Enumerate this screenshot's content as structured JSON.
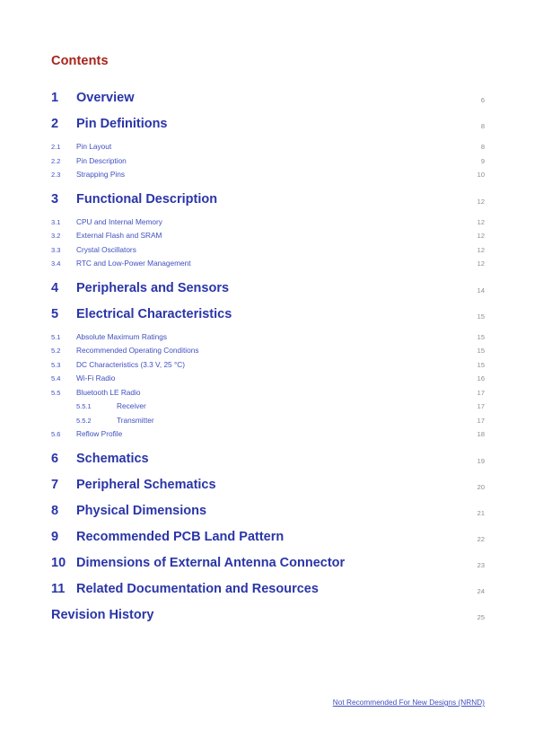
{
  "heading": "Contents",
  "toc": {
    "entries": [
      {
        "level": 1,
        "number": "1",
        "label": "Overview",
        "page": "6"
      },
      {
        "level": 1,
        "number": "2",
        "label": "Pin Definitions",
        "page": "8"
      },
      {
        "level": 2,
        "number": "2.1",
        "label": "Pin Layout",
        "page": "8"
      },
      {
        "level": 2,
        "number": "2.2",
        "label": "Pin Description",
        "page": "9"
      },
      {
        "level": 2,
        "number": "2.3",
        "label": "Strapping Pins",
        "page": "10"
      },
      {
        "level": 1,
        "number": "3",
        "label": "Functional Description",
        "page": "12"
      },
      {
        "level": 2,
        "number": "3.1",
        "label": "CPU and Internal Memory",
        "page": "12"
      },
      {
        "level": 2,
        "number": "3.2",
        "label": "External Flash and SRAM",
        "page": "12"
      },
      {
        "level": 2,
        "number": "3.3",
        "label": "Crystal Oscillators",
        "page": "12"
      },
      {
        "level": 2,
        "number": "3.4",
        "label": "RTC and Low-Power Management",
        "page": "12"
      },
      {
        "level": 1,
        "number": "4",
        "label": "Peripherals and Sensors",
        "page": "14"
      },
      {
        "level": 1,
        "number": "5",
        "label": "Electrical Characteristics",
        "page": "15"
      },
      {
        "level": 2,
        "number": "5.1",
        "label": "Absolute Maximum Ratings",
        "page": "15"
      },
      {
        "level": 2,
        "number": "5.2",
        "label": "Recommended Operating Conditions",
        "page": "15"
      },
      {
        "level": 2,
        "number": "5.3",
        "label": "DC Characteristics (3.3 V, 25 °C)",
        "page": "15"
      },
      {
        "level": 2,
        "number": "5.4",
        "label": "Wi-Fi Radio",
        "page": "16"
      },
      {
        "level": 2,
        "number": "5.5",
        "label": "Bluetooth LE Radio",
        "page": "17"
      },
      {
        "level": 3,
        "number": "5.5.1",
        "label": "Receiver",
        "page": "17"
      },
      {
        "level": 3,
        "number": "5.5.2",
        "label": "Transmitter",
        "page": "17"
      },
      {
        "level": 2,
        "number": "5.6",
        "label": "Reflow Profile",
        "page": "18"
      },
      {
        "level": 1,
        "number": "6",
        "label": "Schematics",
        "page": "19"
      },
      {
        "level": 1,
        "number": "7",
        "label": "Peripheral Schematics",
        "page": "20"
      },
      {
        "level": 1,
        "number": "8",
        "label": "Physical Dimensions",
        "page": "21"
      },
      {
        "level": 1,
        "number": "9",
        "label": "Recommended PCB Land Pattern",
        "page": "22"
      },
      {
        "level": 1,
        "number": "10",
        "label": "Dimensions of External Antenna Connector",
        "page": "23"
      },
      {
        "level": 1,
        "number": "11",
        "label": "Related Documentation and Resources",
        "page": "24"
      },
      {
        "level": 1,
        "number": "",
        "label": "Revision History",
        "page": "25"
      }
    ]
  },
  "footer": {
    "note": "Not Recommended For New Designs (NRND)"
  },
  "colors": {
    "heading": "#a8231a",
    "entry_major": "#2a35a8",
    "entry_minor": "#3f4fc0",
    "page_number": "#8a8a8a",
    "background": "#ffffff"
  }
}
